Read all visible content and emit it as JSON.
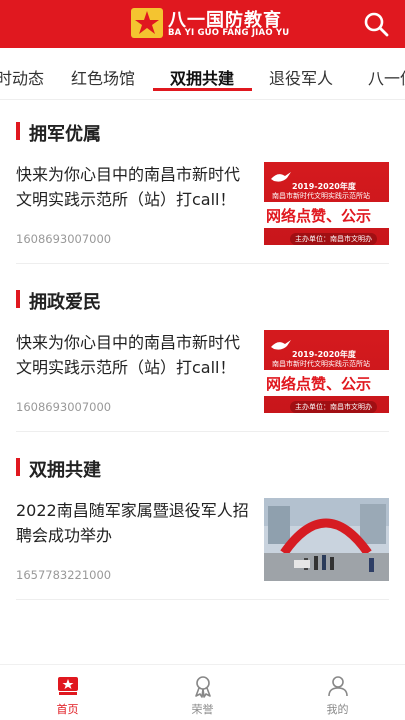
{
  "header": {
    "logo_title": "八一国防教育",
    "logo_subtitle": "BA YI GUO FANG JIAO YU"
  },
  "tabs": [
    {
      "label": "时动态"
    },
    {
      "label": "红色场馆"
    },
    {
      "label": "双拥共建"
    },
    {
      "label": "退役军人"
    },
    {
      "label": "八一侦"
    }
  ],
  "active_tab": "双拥共建",
  "sections": [
    {
      "title": "拥军优属",
      "item": {
        "title": "快来为你心目中的南昌市新时代文明实践示范所（站）打call！",
        "time": "1608693007000",
        "thumb": {
          "year": "2019-2020年度",
          "line": "南昌市新时代文明实践示范所站",
          "headline": "网络点赞、公示",
          "org": "主办单位：南昌市文明办"
        }
      }
    },
    {
      "title": "拥政爱民",
      "item": {
        "title": "快来为你心目中的南昌市新时代文明实践示范所（站）打call！",
        "time": "1608693007000",
        "thumb": {
          "year": "2019-2020年度",
          "line": "南昌市新时代文明实践示范所站",
          "headline": "网络点赞、公示",
          "org": "主办单位：南昌市文明办"
        }
      }
    },
    {
      "title": "双拥共建",
      "item": {
        "title": "2022南昌随军家属暨退役军人招聘会成功举办",
        "time": "1657783221000"
      }
    }
  ],
  "bottom_nav": [
    {
      "label": "首页",
      "icon": "home-emblem-icon"
    },
    {
      "label": "荣誉",
      "icon": "medal-icon"
    },
    {
      "label": "我的",
      "icon": "user-icon"
    }
  ],
  "colors": {
    "brand": "#e0181f",
    "text": "#222222",
    "muted": "#999999"
  }
}
